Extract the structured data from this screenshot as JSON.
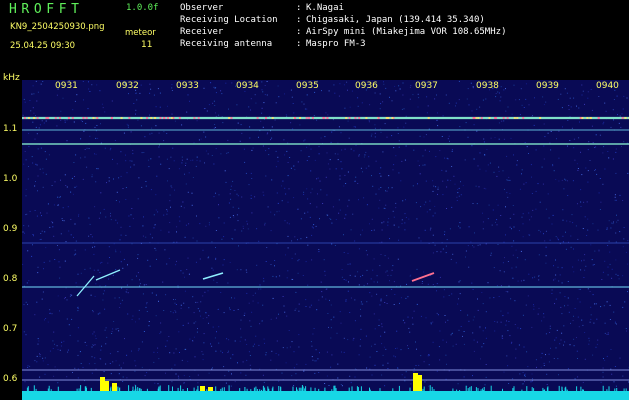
{
  "header": {
    "title": "HROFFT",
    "version": "1.0.0f",
    "filename": "KN9_2504250930.png",
    "meteor_label": "meteor",
    "datetime": "25.04.25 09:30",
    "meteor_count": "11"
  },
  "station_info": [
    {
      "label": "Observer",
      "sep": ":",
      "value": "K.Nagai"
    },
    {
      "label": "Receiving Location",
      "sep": ":",
      "value": "Chigasaki, Japan (139.414 35.340)"
    },
    {
      "label": "Receiver",
      "sep": ":",
      "value": "AirSpy mini (Miakejima VOR 108.65MHz)"
    },
    {
      "label": "Receiving antenna",
      "sep": ":",
      "value": "Maspro FM-3"
    }
  ],
  "spectrogram": {
    "y_unit": "kHz",
    "y_ticks": [
      "1.1",
      "1.0",
      "0.9",
      "0.8",
      "0.7",
      "0.6"
    ],
    "x_ticks": [
      "0931",
      "0932",
      "0933",
      "0934",
      "0935",
      "0936",
      "0937",
      "0938",
      "0939",
      "0940"
    ],
    "colors": {
      "background": "#090a55",
      "noise_light": "#2f5fd8",
      "carrier": "#7fe0c8",
      "carrier_hot": "#ff6a9a",
      "meteor": "#8ff0ff",
      "meteor_hot": "#ff7090",
      "bottom_band": "#17d7e6",
      "bursts": "#ffff00",
      "labels": "#ffff66",
      "header_green": "#5ff05a"
    }
  }
}
